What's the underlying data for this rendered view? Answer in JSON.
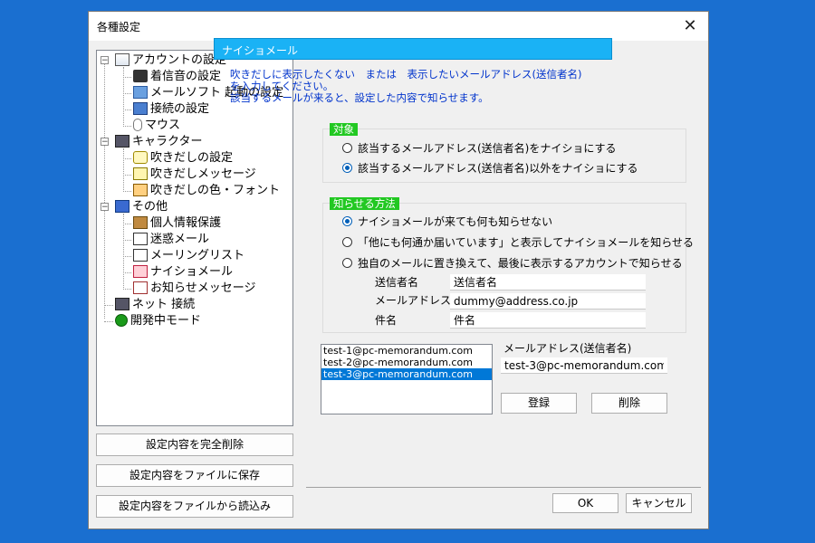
{
  "window": {
    "title": "各種設定",
    "close_glyph": "✕"
  },
  "tree": {
    "items": [
      {
        "label": "アカウントの設定",
        "icon": "mail-lock-icon",
        "level": 0,
        "expander": "−"
      },
      {
        "label": "着信音の設定",
        "icon": "speaker-icon",
        "level": 1
      },
      {
        "label": "メールソフト 起動の設定",
        "icon": "app-launch-icon",
        "level": 1
      },
      {
        "label": "接続の設定",
        "icon": "network-icon",
        "level": 1
      },
      {
        "label": "マウス",
        "icon": "mouse-icon",
        "level": 1
      },
      {
        "label": "キャラクター",
        "icon": "character-icon",
        "level": 0,
        "expander": "−"
      },
      {
        "label": "吹きだしの設定",
        "icon": "speech-bubble-icon",
        "level": 1
      },
      {
        "label": "吹きだしメッセージ",
        "icon": "edit-message-icon",
        "level": 1
      },
      {
        "label": "吹きだしの色・フォント",
        "icon": "font-color-icon",
        "level": 1
      },
      {
        "label": "その他",
        "icon": "folder-icon",
        "level": 0,
        "expander": "−"
      },
      {
        "label": "個人情報保護",
        "icon": "privacy-icon",
        "level": 1
      },
      {
        "label": "迷惑メール",
        "icon": "envelope-icon",
        "level": 1
      },
      {
        "label": "メーリングリスト",
        "icon": "envelope-icon",
        "level": 1
      },
      {
        "label": "ナイショメール",
        "icon": "secret-mail-icon",
        "level": 1
      },
      {
        "label": "お知らせメッセージ",
        "icon": "notice-icon",
        "level": 1
      },
      {
        "label": "ネット 接続",
        "icon": "network-computer-icon",
        "level": 0
      },
      {
        "label": "開発中モード",
        "icon": "help-icon",
        "level": 0
      }
    ]
  },
  "left_buttons": {
    "delete_all": "設定内容を完全削除",
    "save_file": "設定内容をファイルに保存",
    "load_file": "設定内容をファイルから読込み"
  },
  "panel": {
    "header": "ナイショメール",
    "description": [
      "吹きだしに表示したくない　または　表示したいメールアドレス(送信者名)",
      "を入力してください。",
      "該当するメールが来ると、設定した内容で知らせます。"
    ],
    "target_group": {
      "label": "対象",
      "options": [
        {
          "label": "該当するメールアドレス(送信者名)をナイショにする",
          "checked": false
        },
        {
          "label": "該当するメールアドレス(送信者名)以外をナイショにする",
          "checked": true
        }
      ]
    },
    "notify_group": {
      "label": "知らせる方法",
      "options": [
        {
          "label": "ナイショメールが来ても何も知らせない",
          "checked": true
        },
        {
          "label": "「他にも何通か届いています」と表示してナイショメールを知らせる",
          "checked": false
        },
        {
          "label": "独自のメールに置き換えて、最後に表示するアカウントで知らせる",
          "checked": false
        }
      ],
      "fields": {
        "sender_label": "送信者名",
        "sender_value": "送信者名",
        "address_label": "メールアドレス",
        "address_value": "dummy@address.co.jp",
        "subject_label": "件名",
        "subject_value": "件名"
      }
    },
    "address_list": {
      "items": [
        "test-1@pc-memorandum.com",
        "test-2@pc-memorandum.com",
        "test-3@pc-memorandum.com"
      ],
      "selected_index": 2
    },
    "address_input": {
      "label": "メールアドレス(送信者名)",
      "value": "test-3@pc-memorandum.com"
    },
    "register_button": "登録",
    "delete_button": "削除"
  },
  "footer": {
    "ok": "OK",
    "cancel": "キャンセル"
  },
  "colors": {
    "background": "#1a6fd0",
    "header": "#1ab2f5",
    "group_label": "#22c822",
    "description": "#0033cc",
    "selection": "#0078d7"
  }
}
